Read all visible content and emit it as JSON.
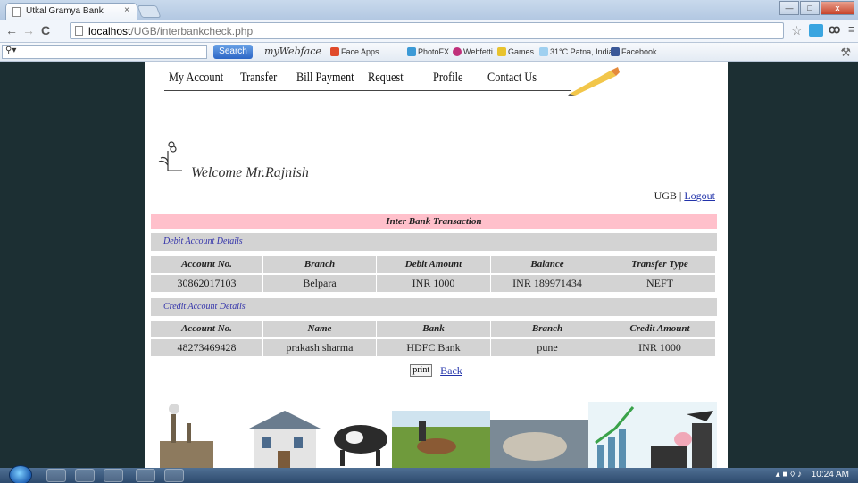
{
  "browser": {
    "tab_title": "Utkal Gramya Bank",
    "tab_close": "×",
    "url_host": "localhost",
    "url_path": "/UGB/interbankcheck.php",
    "toolbar": {
      "search_label": "Search",
      "logo_text": "myWebface",
      "items": [
        "Face Apps",
        "PhotoFX",
        "Webfetti",
        "Games",
        "31°C Patna, India",
        "Facebook"
      ]
    }
  },
  "site": {
    "nav": [
      "My Account",
      "Transfer",
      "Bill Payment",
      "Request",
      "Profile",
      "Contact Us"
    ],
    "welcome": "Welcome Mr.Rajnish",
    "user_prefix": "UGB",
    "separator": "|",
    "logout": "Logout"
  },
  "transaction": {
    "title": "Inter Bank Transaction",
    "debit_heading": "Debit Account Details",
    "debit_columns": [
      "Account No.",
      "Branch",
      "Debit Amount",
      "Balance",
      "Transfer Type"
    ],
    "debit_row": [
      "30862017103",
      "Belpara",
      "INR 1000",
      "INR 189971434",
      "NEFT"
    ],
    "credit_heading": "Credit Account Details",
    "credit_columns": [
      "Account No.",
      "Name",
      "Bank",
      "Branch",
      "Credit Amount"
    ],
    "credit_row": [
      "48273469428",
      "prakash sharma",
      "HDFC Bank",
      "pune",
      "INR 1000"
    ],
    "print_label": "print",
    "back_label": "Back"
  },
  "taskbar": {
    "clock": "10:24 AM"
  }
}
